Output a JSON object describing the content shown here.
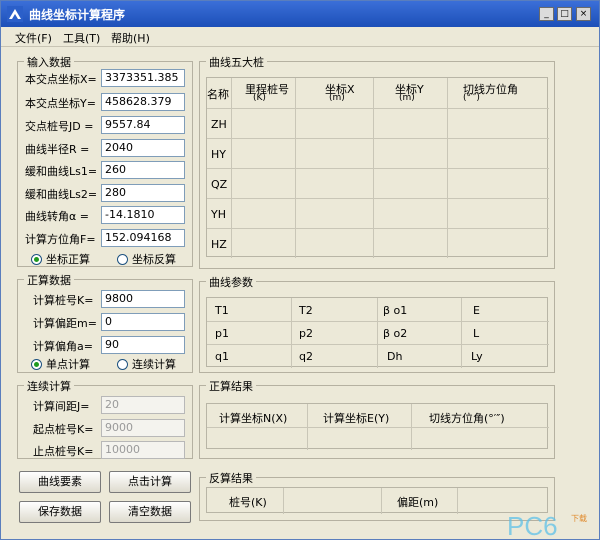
{
  "window": {
    "title": "曲线坐标计算程序"
  },
  "menu": [
    "文件(F)",
    "工具(T)",
    "帮助(H)"
  ],
  "input_group": {
    "title": "输入数据",
    "fields": [
      {
        "label": "本交点坐标X=",
        "value": "3373351.385"
      },
      {
        "label": "本交点坐标Y=",
        "value": "458628.379"
      },
      {
        "label": "交点桩号JD =",
        "value": "9557.84"
      },
      {
        "label": "曲线半径R =",
        "value": "2040"
      },
      {
        "label": "缓和曲线Ls1=",
        "value": "260"
      },
      {
        "label": "缓和曲线Ls2=",
        "value": "280"
      },
      {
        "label": "曲线转角α =",
        "value": "-14.1810"
      },
      {
        "label": "计算方位角F=",
        "value": "152.094168"
      }
    ],
    "radio1": "坐标正算",
    "radio2": "坐标反算"
  },
  "forward_group": {
    "title": "正算数据",
    "fields": [
      {
        "label": "计算桩号K=",
        "value": "9800"
      },
      {
        "label": "计算偏距m=",
        "value": "0"
      },
      {
        "label": "计算偏角a=",
        "value": "90"
      }
    ],
    "radio1": "单点计算",
    "radio2": "连续计算"
  },
  "continuous_group": {
    "title": "连续计算",
    "fields": [
      {
        "label": "计算间距J=",
        "value": "20"
      },
      {
        "label": "起点桩号K=",
        "value": "9000"
      },
      {
        "label": "止点桩号K=",
        "value": "10000"
      }
    ]
  },
  "buttons": {
    "curve_elements": "曲线要素",
    "click_compute": "点击计算",
    "save_data": "保存数据",
    "clear_data": "清空数据"
  },
  "five_stakes": {
    "title": "曲线五大桩",
    "headers": [
      "名称",
      "里程桩号",
      "(K)",
      "坐标X",
      "(m)",
      "坐标Y",
      "(m)",
      "切线方位角",
      "(°′″)"
    ],
    "rows": [
      "ZH",
      "HY",
      "QZ",
      "YH",
      "HZ"
    ]
  },
  "curve_params": {
    "title": "曲线参数",
    "labels": [
      "T1",
      "T2",
      "β o1",
      "E",
      "p1",
      "p2",
      "β o2",
      "L",
      "q1",
      "q2",
      "Dh",
      "Ly"
    ]
  },
  "forward_result": {
    "title": "正算结果",
    "headers": [
      "计算坐标N(X)",
      "计算坐标E(Y)",
      "切线方位角(°′″)"
    ]
  },
  "inverse_result": {
    "title": "反算结果",
    "headers": [
      "桩号(K)",
      "偏距(m)"
    ]
  }
}
